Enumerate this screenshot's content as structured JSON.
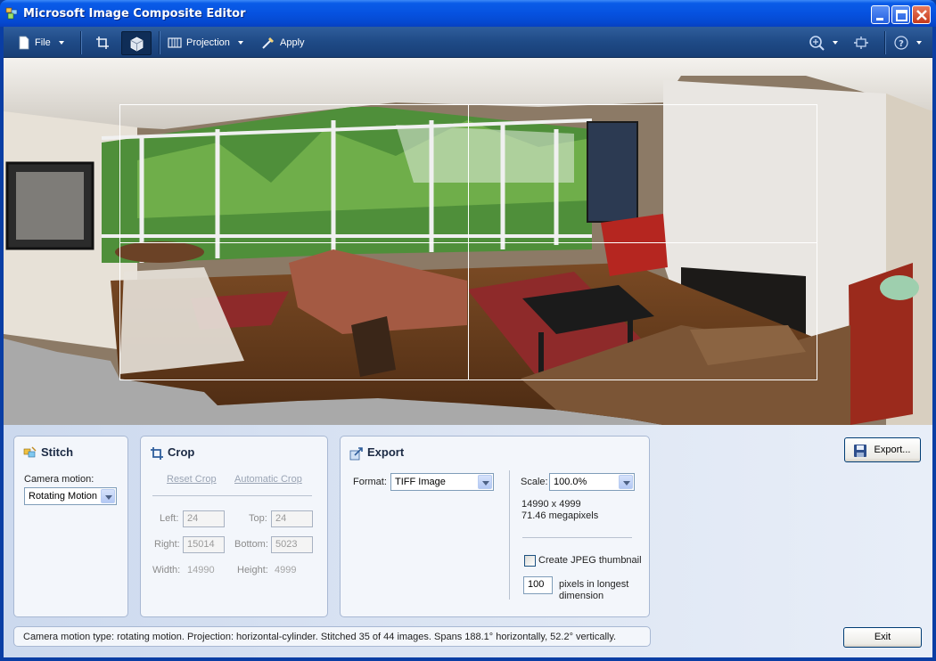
{
  "window": {
    "title": "Microsoft Image Composite Editor"
  },
  "toolbar": {
    "file_label": "File",
    "projection_label": "Projection",
    "apply_label": "Apply"
  },
  "stitch": {
    "title": "Stitch",
    "camera_motion_label": "Camera motion:",
    "camera_motion_value": "Rotating Motion"
  },
  "crop": {
    "title": "Crop",
    "reset_label": "Reset Crop",
    "automatic_label": "Automatic Crop",
    "left_label": "Left:",
    "left_value": "24",
    "top_label": "Top:",
    "top_value": "24",
    "right_label": "Right:",
    "right_value": "15014",
    "bottom_label": "Bottom:",
    "bottom_value": "5023",
    "width_label": "Width:",
    "width_value": "14990",
    "height_label": "Height:",
    "height_value": "4999"
  },
  "export": {
    "title": "Export",
    "format_label": "Format:",
    "format_value": "TIFF Image",
    "scale_label": "Scale:",
    "scale_value": "100.0%",
    "dimensions": "14990 x 4999",
    "megapixels": "71.46 megapixels",
    "thumbnail_label": "Create JPEG thumbnail",
    "thumbnail_checked": false,
    "pixels_value": "100",
    "pixels_label_1": "pixels in longest",
    "pixels_label_2": "dimension",
    "export_button": "Export...",
    "exit_button": "Exit"
  },
  "status": {
    "text": "Camera motion type: rotating motion. Projection: horizontal-cylinder. Stitched 35 of 44 images. Spans 188.1° horizontally, 52.2° vertically."
  },
  "colors": {
    "titlebar": "#0652e0",
    "toolbar": "#1f4a86",
    "panel_bg": "#f3f6fb",
    "canvas_bg": "#a9a9a9"
  }
}
